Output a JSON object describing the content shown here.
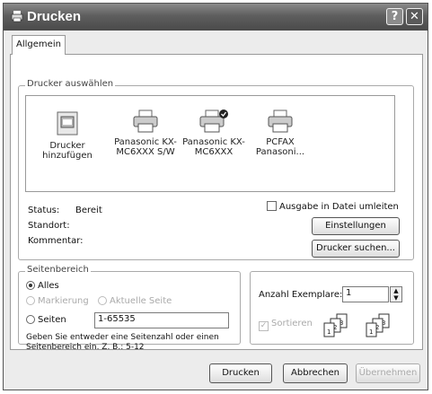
{
  "title": "Drucken",
  "tab": "Allgemein",
  "printer_group": "Drucker auswählen",
  "printers": [
    {
      "name": "Drucker hinzufügen",
      "icon": "add-printer-icon"
    },
    {
      "name": "Panasonic KX-MC6XXX S/W",
      "icon": "printer-icon"
    },
    {
      "name": "Panasonic KX-MC6XXX",
      "icon": "default-printer-icon"
    },
    {
      "name": "PCFAX Panasoni...",
      "icon": "fax-printer-icon"
    }
  ],
  "status": {
    "label": "Status:",
    "value": "Bereit"
  },
  "location": {
    "label": "Standort:"
  },
  "comment": {
    "label": "Kommentar:"
  },
  "print_to_file": "Ausgabe in Datei umleiten",
  "settings_button": "Einstellungen",
  "find_printer_button": "Drucker suchen...",
  "page_range": {
    "legend": "Seitenbereich",
    "all": "Alles",
    "selection": "Markierung",
    "current_page": "Aktuelle Seite",
    "pages": "Seiten",
    "pages_value": "1-65535",
    "hint": "Geben Sie entweder eine Seitenzahl oder einen Seitenbereich ein. Z. B.: 5-12"
  },
  "copies": {
    "label": "Anzahl Exemplare:",
    "value": "1"
  },
  "collate": {
    "label": "Sortieren"
  },
  "buttons": {
    "print": "Drucken",
    "cancel": "Abbrechen",
    "apply": "Übernehmen"
  }
}
